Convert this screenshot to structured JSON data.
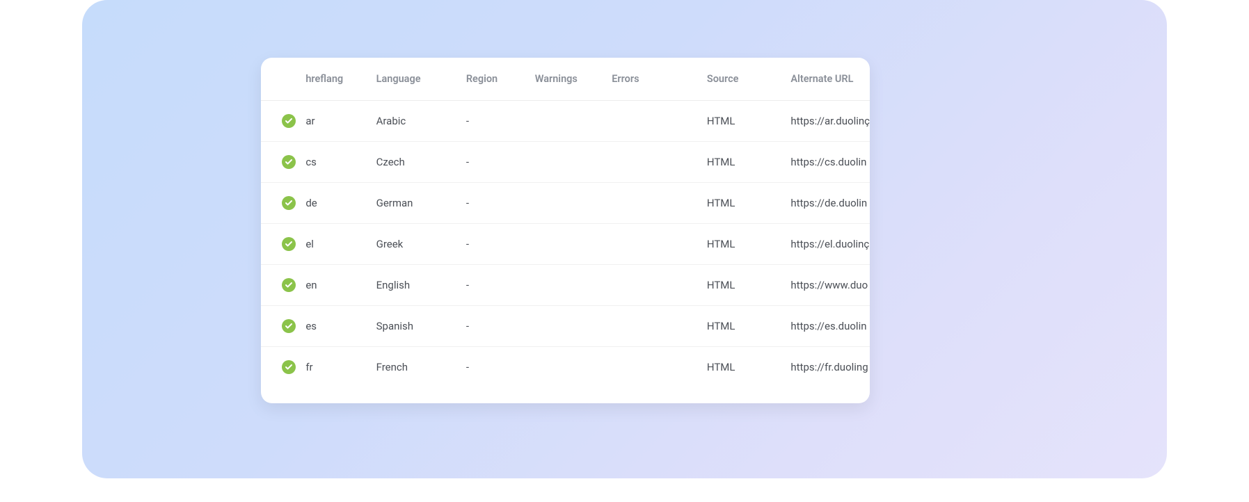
{
  "table": {
    "headers": {
      "status": "",
      "hreflang": "hreflang",
      "language": "Language",
      "region": "Region",
      "warnings": "Warnings",
      "errors": "Errors",
      "source": "Source",
      "alternate_url": "Alternate URL"
    },
    "rows": [
      {
        "status": "ok",
        "hreflang": "ar",
        "language": "Arabic",
        "region": "-",
        "warnings": "",
        "errors": "",
        "source": "HTML",
        "alternate_url": "https://ar.duolinç"
      },
      {
        "status": "ok",
        "hreflang": "cs",
        "language": "Czech",
        "region": "-",
        "warnings": "",
        "errors": "",
        "source": "HTML",
        "alternate_url": "https://cs.duolin"
      },
      {
        "status": "ok",
        "hreflang": "de",
        "language": "German",
        "region": "-",
        "warnings": "",
        "errors": "",
        "source": "HTML",
        "alternate_url": "https://de.duolin"
      },
      {
        "status": "ok",
        "hreflang": "el",
        "language": "Greek",
        "region": "-",
        "warnings": "",
        "errors": "",
        "source": "HTML",
        "alternate_url": "https://el.duolinç"
      },
      {
        "status": "ok",
        "hreflang": "en",
        "language": "English",
        "region": "-",
        "warnings": "",
        "errors": "",
        "source": "HTML",
        "alternate_url": "https://www.duo"
      },
      {
        "status": "ok",
        "hreflang": "es",
        "language": "Spanish",
        "region": "-",
        "warnings": "",
        "errors": "",
        "source": "HTML",
        "alternate_url": "https://es.duolin"
      },
      {
        "status": "ok",
        "hreflang": "fr",
        "language": "French",
        "region": "-",
        "warnings": "",
        "errors": "",
        "source": "HTML",
        "alternate_url": "https://fr.duoling"
      }
    ]
  },
  "colors": {
    "check_green": "#8bc34a",
    "header_text": "#8a8f98",
    "body_text": "#4b4f56"
  }
}
